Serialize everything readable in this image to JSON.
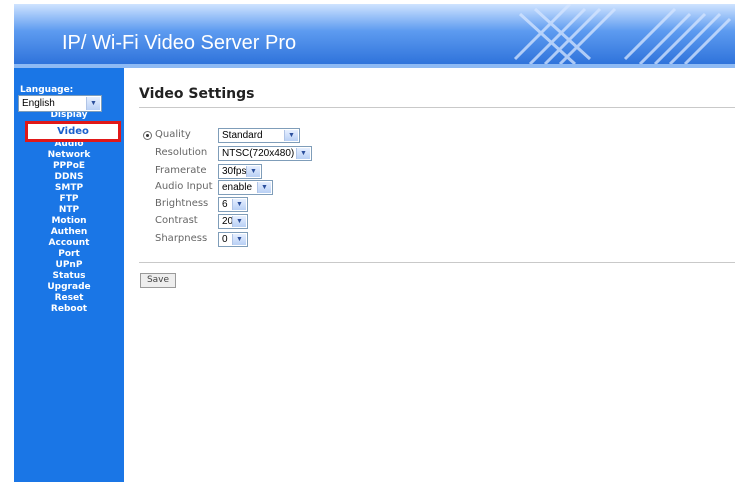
{
  "header": {
    "title": "IP/ Wi-Fi Video Server Pro"
  },
  "sidebar": {
    "language_label": "Language:",
    "language_value": "English",
    "items": [
      {
        "label": "Display"
      },
      {
        "label": "Video"
      },
      {
        "label": "Audio"
      },
      {
        "label": "Network"
      },
      {
        "label": "PPPoE"
      },
      {
        "label": "DDNS"
      },
      {
        "label": "SMTP"
      },
      {
        "label": "FTP"
      },
      {
        "label": "NTP"
      },
      {
        "label": "Motion"
      },
      {
        "label": "Authen"
      },
      {
        "label": "Account"
      },
      {
        "label": "Port"
      },
      {
        "label": "UPnP"
      },
      {
        "label": "Status"
      },
      {
        "label": "Upgrade"
      },
      {
        "label": "Reset"
      },
      {
        "label": "Reboot"
      }
    ]
  },
  "main": {
    "title": "Video Settings",
    "fields": {
      "quality": {
        "label": "Quality",
        "value": "Standard"
      },
      "resolution": {
        "label": "Resolution",
        "value": "NTSC(720x480)"
      },
      "framerate": {
        "label": "Framerate",
        "value": "30fps"
      },
      "audio_input": {
        "label": "Audio Input",
        "value": "enable"
      },
      "brightness": {
        "label": "Brightness",
        "value": "6"
      },
      "contrast": {
        "label": "Contrast",
        "value": "20"
      },
      "sharpness": {
        "label": "Sharpness",
        "value": "0"
      }
    },
    "save_label": "Save"
  },
  "colors": {
    "sidebar_bg": "#1a76e6",
    "header_blue": "#2f73db",
    "highlight_border": "#e01818"
  },
  "icons": {
    "dropdown": "chevron-down-icon",
    "radio": "radio-selected-icon"
  }
}
